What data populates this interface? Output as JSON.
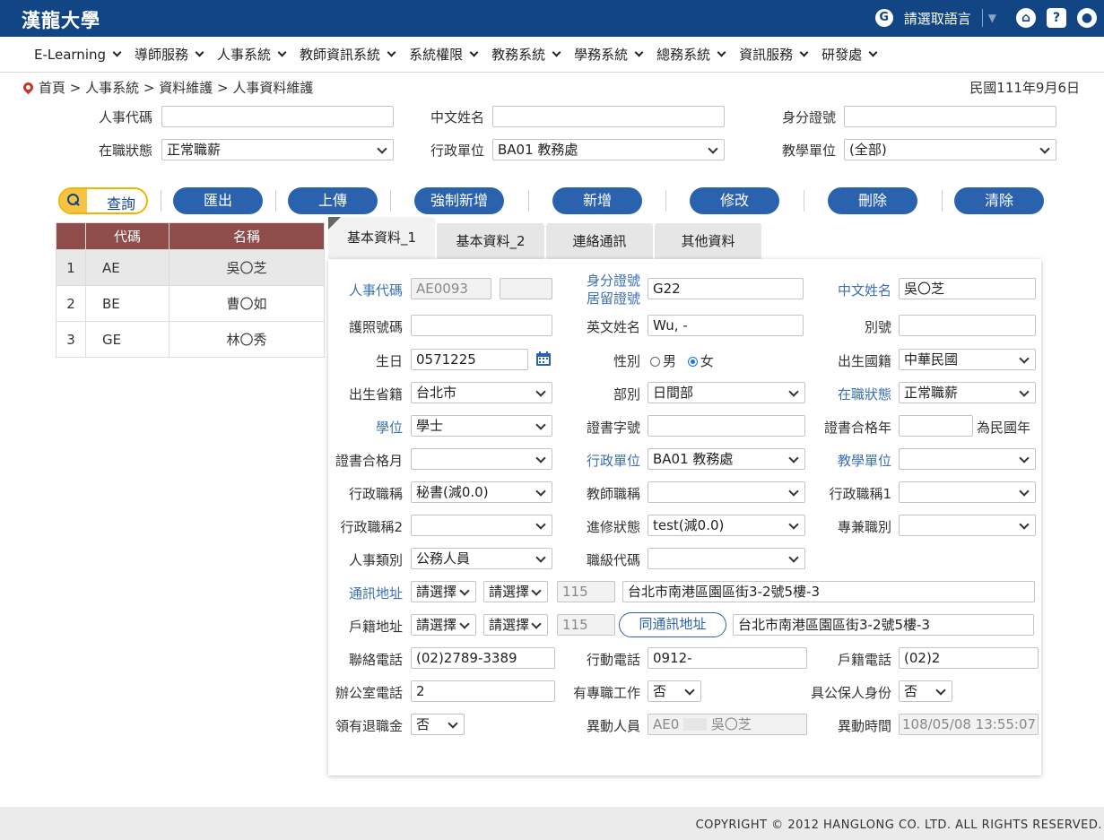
{
  "header": {
    "logo": "漢龍大學",
    "language_label": "請選取語言",
    "home_icon": "home-icon",
    "help_icon": "help-icon",
    "user_icon": "user-icon"
  },
  "menu": [
    "E-Learning",
    "導師服務",
    "人事系統",
    "教師資訊系統",
    "系統權限",
    "教務系統",
    "學務系統",
    "總務系統",
    "資訊服務",
    "研發處"
  ],
  "breadcrumb": "首頁 > 人事系統 > 資料維護 > 人事資料維護",
  "date": "民國111年9月6日",
  "query": {
    "staff_code_label": "人事代碼",
    "staff_code_value": "",
    "name_label": "中文姓名",
    "name_value": "",
    "id_label": "身分證號",
    "id_value": "",
    "status_label": "在職狀態",
    "status_value": "正常職薪",
    "admin_unit_label": "行政單位",
    "admin_unit_value": "BA01 教務處",
    "teach_unit_label": "教學單位",
    "teach_unit_value": "(全部)"
  },
  "buttons": {
    "query": "查詢",
    "export": "匯出",
    "upload": "上傳",
    "force_add": "強制新增",
    "add": "新增",
    "edit": "修改",
    "delete": "刪除",
    "clear": "清除"
  },
  "grid": {
    "headers": [
      "代碼",
      "名稱"
    ],
    "rows": [
      {
        "no": "1",
        "code": "AE",
        "name": "吳〇芝"
      },
      {
        "no": "2",
        "code": "BE",
        "name": "曹〇如"
      },
      {
        "no": "3",
        "code": "GE",
        "name": "林〇秀"
      }
    ]
  },
  "tabs": [
    "基本資料_1",
    "基本資料_2",
    "連絡通訊",
    "其他資料"
  ],
  "form": {
    "staff_code_label": "人事代碼",
    "staff_code": "AE0093",
    "id_label_1": "身分證號",
    "id_label_2": "居留證號",
    "id_no": "G22",
    "cname_label": "中文姓名",
    "cname": "吳〇芝",
    "passport_label": "護照號碼",
    "passport": "",
    "ename_label": "英文姓名",
    "ename": "Wu, -",
    "alias_label": "別號",
    "alias": "",
    "birth_label": "生日",
    "birth": "0571225",
    "gender_label": "性別",
    "gender_male": "男",
    "gender_female": "女",
    "nationality_label": "出生國籍",
    "nationality": "中華民國",
    "province_label": "出生省籍",
    "province": "台北市",
    "division_label": "部別",
    "division": "日間部",
    "status_label": "在職狀態",
    "status": "正常職薪",
    "degree_label": "學位",
    "degree": "學士",
    "cert_no_label": "證書字號",
    "cert_no": "",
    "cert_year_label": "證書合格年",
    "cert_year": "",
    "cert_year_suffix": "為民國年",
    "cert_month_label": "證書合格月",
    "cert_month": "",
    "admin_unit_label": "行政單位",
    "admin_unit": "BA01 教務處",
    "teach_unit_label": "教學單位",
    "teach_unit": "",
    "admin_title_label": "行政職稱",
    "admin_title": "秘書(減0.0)",
    "teacher_title_label": "教師職稱",
    "teacher_title": "",
    "admin_title1_label": "行政職稱1",
    "admin_title1": "",
    "admin_title2_label": "行政職稱2",
    "admin_title2": "",
    "study_status_label": "進修狀態",
    "study_status": "test(減0.0)",
    "concurrent_label": "專兼職別",
    "concurrent": "",
    "personnel_type_label": "人事類別",
    "personnel_type": "公務人員",
    "grade_code_label": "職級代碼",
    "grade_code": "",
    "mail_addr_label": "通訊地址",
    "mail_city": "請選擇",
    "mail_district": "請選擇",
    "mail_zip": "115",
    "mail_addr": "台北市南港區園區街3-2號5樓-3",
    "reg_addr_label": "戶籍地址",
    "reg_city": "請選擇",
    "reg_district": "請選擇",
    "reg_zip": "115",
    "same_addr_button": "同通訊地址",
    "reg_addr": "台北市南港區園區街3-2號5樓-3",
    "phone_label": "聯絡電話",
    "phone": "(02)2789-3389",
    "mobile_label": "行動電話",
    "mobile": "0912-",
    "reg_phone_label": "戶籍電話",
    "reg_phone": "(02)2",
    "office_phone_label": "辦公室電話",
    "office_phone": "2",
    "fulltime_job_label": "有專職工作",
    "fulltime_job": "否",
    "civil_insurance_label": "具公保人身份",
    "civil_insurance": "否",
    "pension_label": "領有退職金",
    "pension": "否",
    "changer_label": "異動人員",
    "changer_code": "AE0",
    "changer_name": "吳〇芝",
    "change_time_label": "異動時間",
    "change_time": "108/05/08 13:55:07"
  },
  "footer": "COPYRIGHT © 2012 HANGLONG CO. LTD. ALL RIGHTS RESERVED."
}
